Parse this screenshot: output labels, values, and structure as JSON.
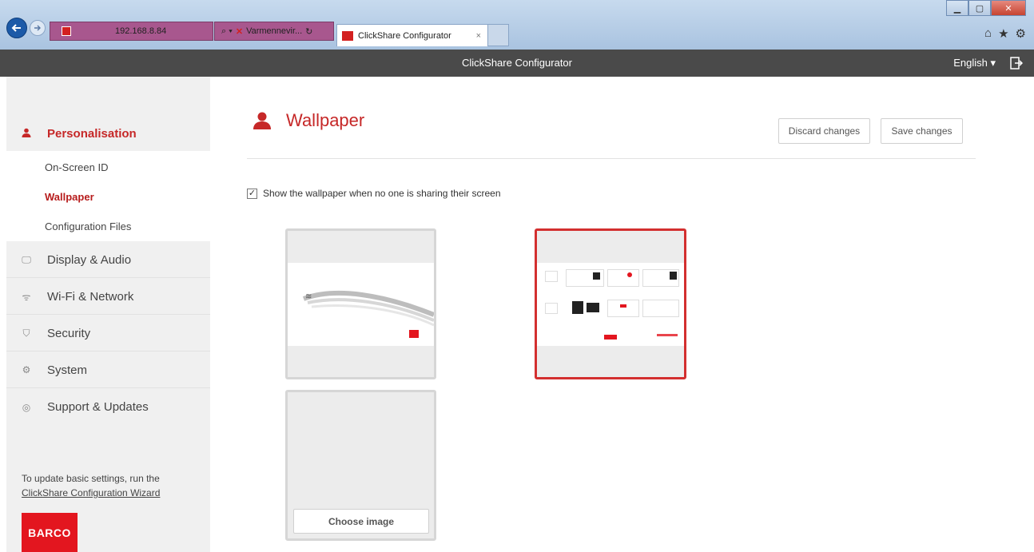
{
  "browser": {
    "address": "192.168.8.84",
    "search_tab_label": "Varmennevir...",
    "active_tab_label": "ClickShare Configurator",
    "tab_close": "×",
    "icons": [
      "back-icon",
      "forward-icon",
      "home-icon",
      "star-icon",
      "gear-icon"
    ]
  },
  "app": {
    "title": "ClickShare Configurator",
    "language": "English ▾"
  },
  "sidebar": {
    "items": [
      {
        "label": "Personalisation",
        "icon": "user-icon",
        "active": true
      },
      {
        "label": "Display & Audio",
        "icon": "monitor-icon"
      },
      {
        "label": "Wi-Fi & Network",
        "icon": "wifi-icon"
      },
      {
        "label": "Security",
        "icon": "shield-icon"
      },
      {
        "label": "System",
        "icon": "gear-icon"
      },
      {
        "label": "Support & Updates",
        "icon": "lifebuoy-icon"
      }
    ],
    "subitems": [
      {
        "label": "On-Screen ID"
      },
      {
        "label": "Wallpaper",
        "active": true
      },
      {
        "label": "Configuration Files"
      }
    ],
    "note_text": "To update basic settings, run the",
    "note_link": "ClickShare Configuration Wizard",
    "logo_text": "BARCO"
  },
  "main": {
    "title": "Wallpaper",
    "discard_label": "Discard changes",
    "save_label": "Save changes",
    "show_wallpaper_label": "Show the wallpaper when no one is sharing their screen",
    "show_wallpaper_checked": true,
    "choose_image_label": "Choose image"
  },
  "colors": {
    "accent": "#c62828",
    "header_bg": "#4a4a4a",
    "sidebar_bg": "#f0f0f0"
  }
}
